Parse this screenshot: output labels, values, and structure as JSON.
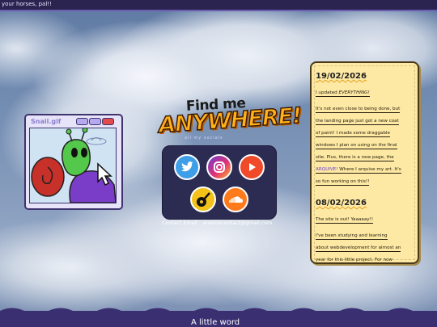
{
  "topbar": {
    "text": "your horses, pal!!"
  },
  "snail_window": {
    "title": "Snail.gif"
  },
  "find": {
    "line1": "Find me",
    "line2": "ANYWHERE!",
    "subtitle": "all my socials"
  },
  "social": {
    "icons": [
      "twitter-icon",
      "instagram-icon",
      "youtube-icon",
      "guitar-icon",
      "soundcloud-icon"
    ],
    "contact": "Contact Email : arsenincontact@gmail.com"
  },
  "news": {
    "entries": [
      {
        "date": "19/02/2026",
        "lines": [
          "I updated EVERYTHING!",
          "It's not even close to being done, but",
          "the landing page just got a new coat",
          "of paint! I made some draggable",
          "windows I plan on using on the final",
          "site. Plus, there is a new page, the",
          "Where I arquive my art. It's",
          "so fun working on this!!"
        ],
        "link": "ARQUIVE!"
      },
      {
        "date": "08/02/2026",
        "lines": [
          "The site is out! Yaaaaay!!",
          "I've been studying and learning",
          "about webdevelopment for almost an",
          "year for this little project. For now"
        ]
      }
    ]
  },
  "bottom": {
    "text": "A little word"
  },
  "colors": {
    "accent": "#6c5fb0",
    "panel": "#2c2b52",
    "news_bg": "#fde9a3",
    "title_orange": "#ffb01a"
  }
}
